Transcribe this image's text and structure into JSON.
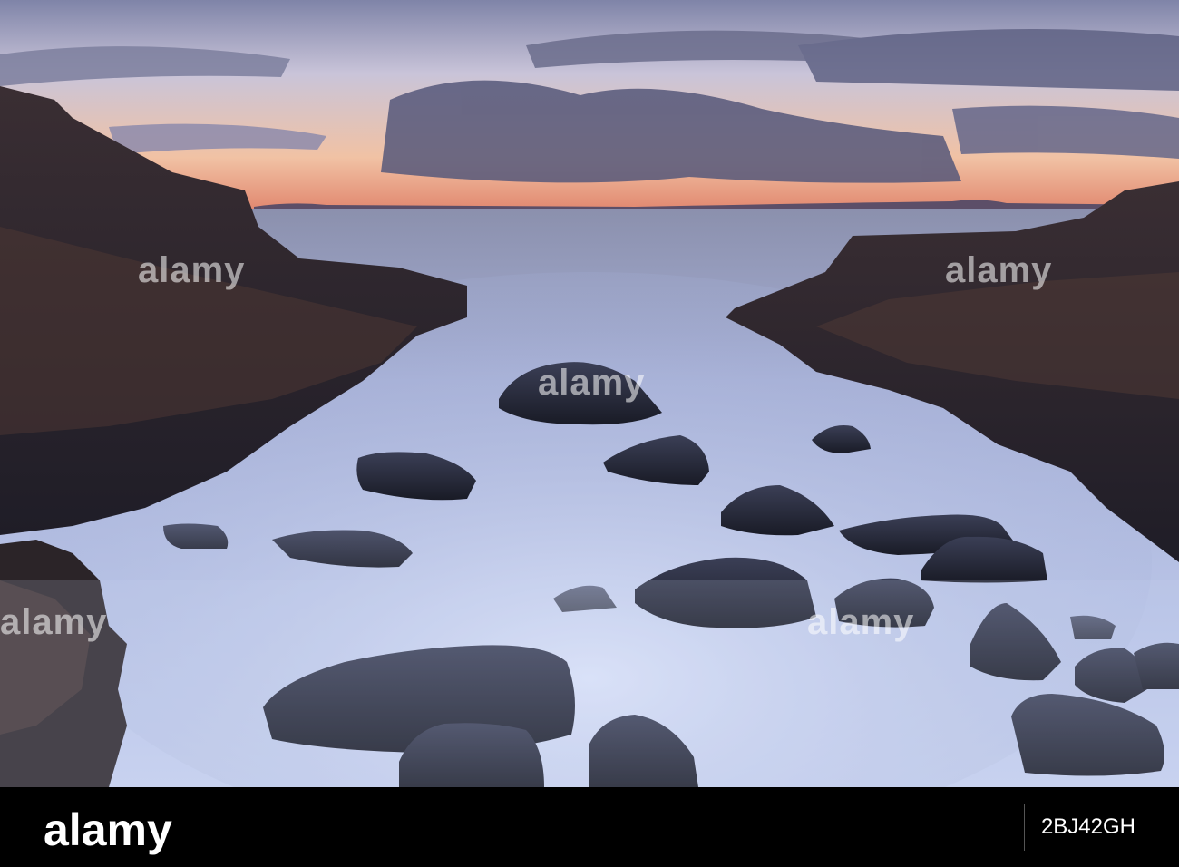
{
  "image": {
    "alt_subject": "long exposure rocky coastal inlet at dusk",
    "palette": {
      "sky_top": "#8c8fb2",
      "sky_glow": "#f2c7a6",
      "horizon": "#e28e73",
      "sea": "#aeb8de",
      "mist": "#cfd8f2",
      "rock_dark": "#2a2530",
      "rock_warm": "#5a3b35"
    }
  },
  "watermark": {
    "text": "alamy",
    "color": "#ffffff"
  },
  "footer": {
    "logo": "alamy",
    "image_id": "2BJ42GH",
    "background": "#000000"
  }
}
